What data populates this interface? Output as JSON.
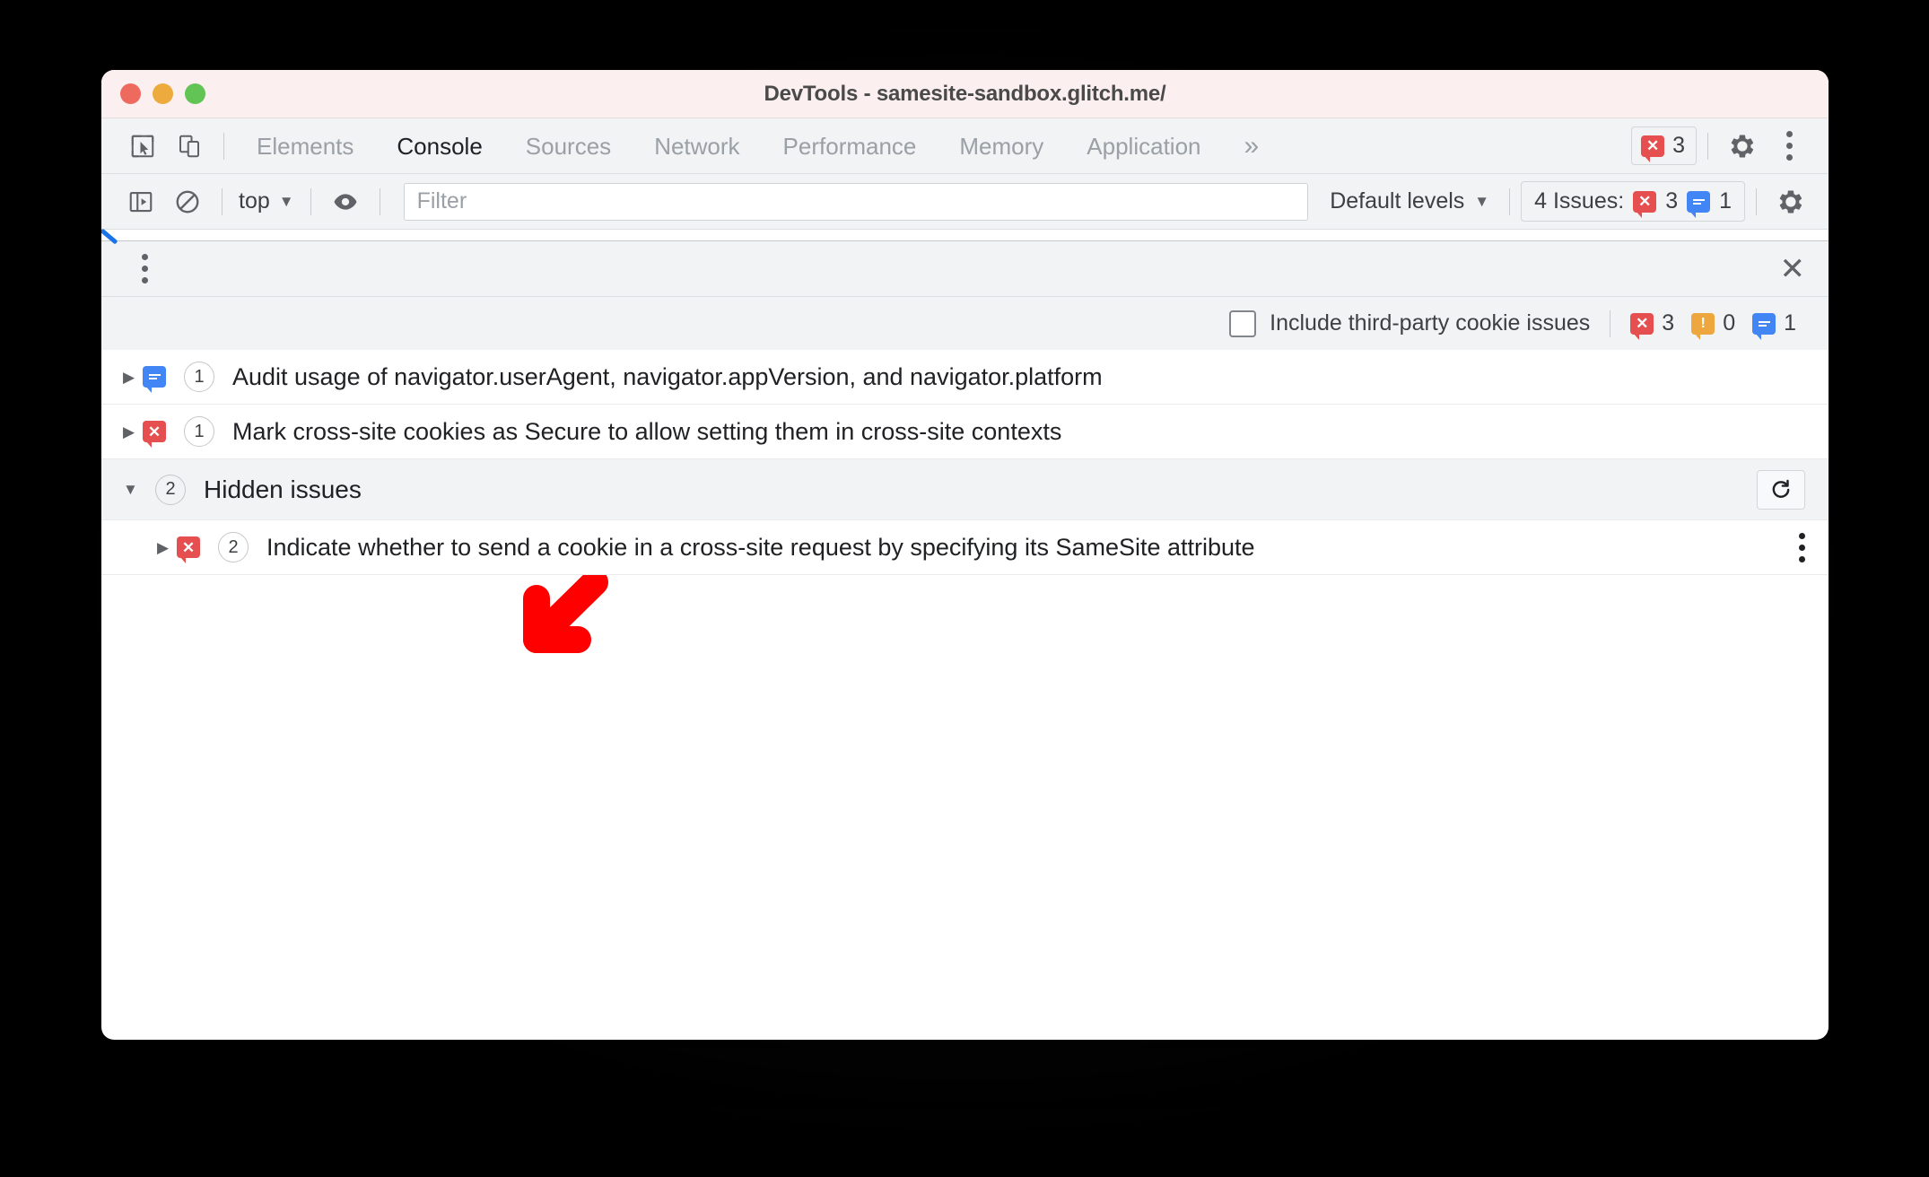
{
  "window": {
    "title": "DevTools - samesite-sandbox.glitch.me/",
    "traffic_lights": [
      "close-red",
      "minimize-yellow",
      "maximize-green"
    ],
    "colors": {
      "titlebar_bg": "#fbeff0",
      "toolbar_bg": "#f1f3f4",
      "accent_blue": "#4285f4",
      "error_red": "#e64f4f",
      "warning_orange": "#eda73e",
      "annotation_red": "#ff0000"
    }
  },
  "tabbar": {
    "inspect_icon": "inspect-element-icon",
    "device_icon": "device-toolbar-icon",
    "tabs": [
      {
        "label": "Elements",
        "active": false
      },
      {
        "label": "Console",
        "active": true
      },
      {
        "label": "Sources",
        "active": false
      },
      {
        "label": "Network",
        "active": false
      },
      {
        "label": "Performance",
        "active": false
      },
      {
        "label": "Memory",
        "active": false
      },
      {
        "label": "Application",
        "active": false
      }
    ],
    "more_tabs_glyph": "»",
    "error_badge": {
      "icon": "error-bubble-icon",
      "count": "3"
    },
    "settings_icon": "gear-icon",
    "main_menu_icon": "kebab-menu-icon"
  },
  "console_toolbar": {
    "sidebar_toggle_icon": "console-sidebar-icon",
    "clear_console_icon": "clear-console-icon",
    "context": {
      "label": "top",
      "caret": "▼"
    },
    "eye_icon": "live-expression-eye-icon",
    "filter": {
      "value": "",
      "placeholder": "Filter"
    },
    "levels": {
      "label": "Default levels",
      "caret": "▼"
    },
    "issues_button": {
      "label": "4 Issues:",
      "error_count": "3",
      "info_count": "1"
    },
    "console_settings_icon": "gear-icon"
  },
  "drawer": {
    "menu_icon": "kebab-menu-icon",
    "close_icon": "close-icon",
    "third_party_checkbox": {
      "label": "Include third-party cookie issues",
      "checked": false
    },
    "counts": {
      "error": "3",
      "warning": "0",
      "info": "1"
    }
  },
  "issues": [
    {
      "kind": "info",
      "icon": "info-bubble-icon",
      "count": "1",
      "expander": "▶",
      "title": "Audit usage of navigator.userAgent, navigator.appVersion, and navigator.platform"
    },
    {
      "kind": "error",
      "icon": "error-bubble-icon",
      "count": "1",
      "expander": "▶",
      "title": "Mark cross-site cookies as Secure to allow setting them in cross-site contexts"
    }
  ],
  "hidden_issues_group": {
    "expander": "▼",
    "count": "2",
    "title": "Hidden issues",
    "refresh_icon": "refresh-icon",
    "children": [
      {
        "kind": "error",
        "icon": "error-bubble-icon",
        "count": "2",
        "expander": "▶",
        "title": "Indicate whether to send a cookie in a cross-site request by specifying its SameSite attribute",
        "menu_icon": "kebab-menu-icon"
      }
    ]
  },
  "annotation": {
    "arrow": "red-arrow-pointing-down-left",
    "color": "#ff0000"
  }
}
